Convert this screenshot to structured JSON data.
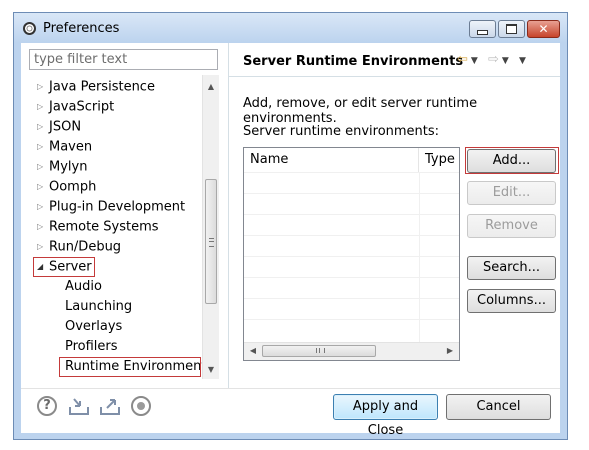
{
  "window": {
    "title": "Preferences",
    "icon": "gear-icon",
    "controls": [
      "minimize",
      "maximize",
      "close"
    ]
  },
  "filter": {
    "placeholder": "type filter text",
    "value": ""
  },
  "tree": {
    "items": [
      {
        "label": "Java Persistence",
        "level": 0,
        "expanded": false
      },
      {
        "label": "JavaScript",
        "level": 0,
        "expanded": false
      },
      {
        "label": "JSON",
        "level": 0,
        "expanded": false
      },
      {
        "label": "Maven",
        "level": 0,
        "expanded": false
      },
      {
        "label": "Mylyn",
        "level": 0,
        "expanded": false
      },
      {
        "label": "Oomph",
        "level": 0,
        "expanded": false
      },
      {
        "label": "Plug-in Development",
        "level": 0,
        "expanded": false
      },
      {
        "label": "Remote Systems",
        "level": 0,
        "expanded": false
      },
      {
        "label": "Run/Debug",
        "level": 0,
        "expanded": false
      },
      {
        "label": "Server",
        "level": 0,
        "expanded": true,
        "highlighted": true
      },
      {
        "label": "Audio",
        "level": 1
      },
      {
        "label": "Launching",
        "level": 1
      },
      {
        "label": "Overlays",
        "level": 1
      },
      {
        "label": "Profilers",
        "level": 1
      },
      {
        "label": "Runtime Environments",
        "level": 1,
        "selected": true,
        "highlighted": true
      }
    ]
  },
  "page": {
    "title": "Server Runtime Environments",
    "description": "Add, remove, or edit server runtime environments.",
    "list_label": "Server runtime environments:",
    "table": {
      "columns": [
        "Name",
        "Type"
      ],
      "rows": []
    }
  },
  "buttons": {
    "add": "Add...",
    "edit": "Edit...",
    "remove": "Remove",
    "search": "Search...",
    "columns": "Columns...",
    "apply_close": "Apply and Close",
    "cancel": "Cancel"
  },
  "colors": {
    "highlight_border": "#c43a3a",
    "default_button": "#3c7fb1",
    "window_frame": "#bcd3ee"
  }
}
